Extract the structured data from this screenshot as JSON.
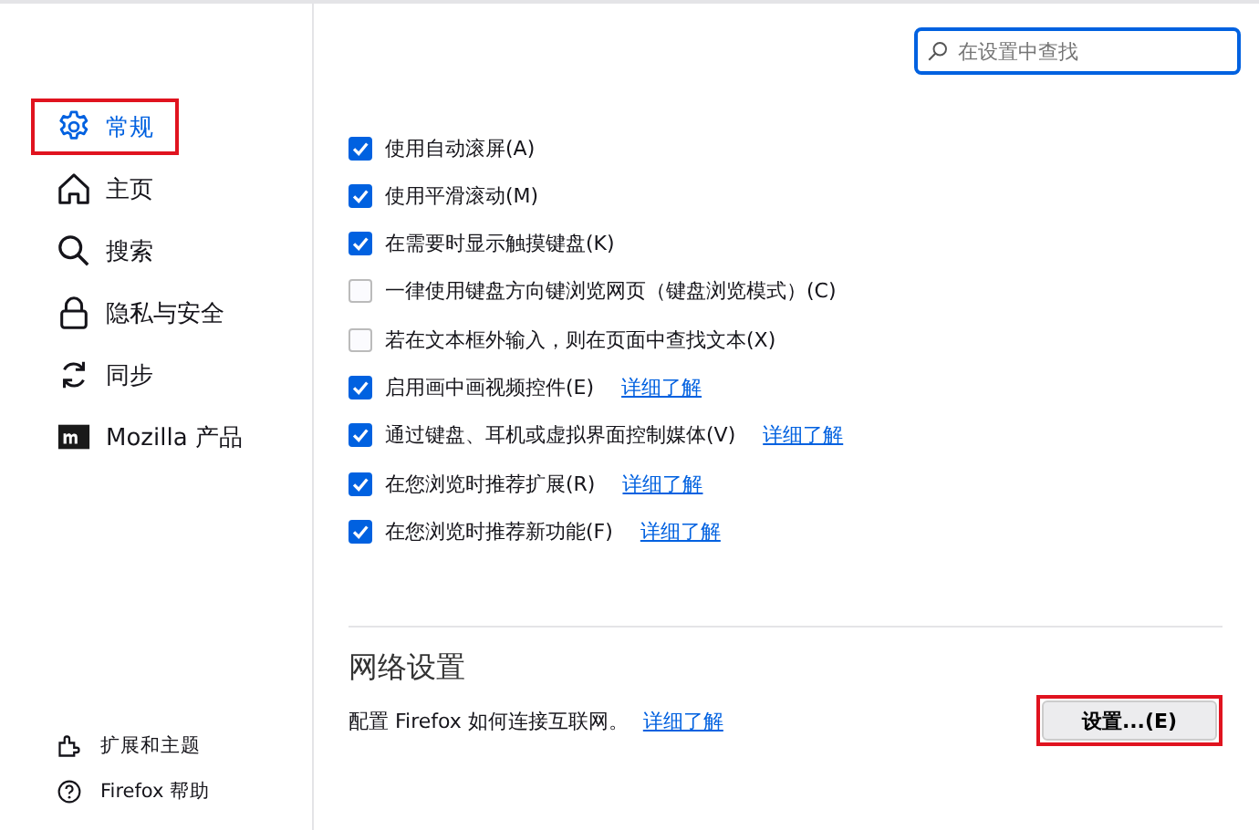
{
  "sidebar": {
    "items": [
      {
        "label": "常规",
        "kind": "gear",
        "selected": true,
        "highlighted": true
      },
      {
        "label": "主页",
        "kind": "home",
        "selected": false,
        "highlighted": false
      },
      {
        "label": "搜索",
        "kind": "search",
        "selected": false,
        "highlighted": false
      },
      {
        "label": "隐私与安全",
        "kind": "lock",
        "selected": false,
        "highlighted": false
      },
      {
        "label": "同步",
        "kind": "sync",
        "selected": false,
        "highlighted": false
      },
      {
        "label": "Mozilla 产品",
        "kind": "mozilla",
        "selected": false,
        "highlighted": false
      }
    ],
    "footer": [
      {
        "label": "扩展和主题",
        "kind": "puzzle"
      },
      {
        "label": "Firefox 帮助",
        "kind": "help"
      }
    ]
  },
  "search": {
    "placeholder": "在设置中查找"
  },
  "options": [
    {
      "label": "使用自动滚屏(A)",
      "checked": true
    },
    {
      "label": "使用平滑滚动(M)",
      "checked": true
    },
    {
      "label": "在需要时显示触摸键盘(K)",
      "checked": true
    },
    {
      "label": "一律使用键盘方向键浏览网页（键盘浏览模式）(C)",
      "checked": false
    },
    {
      "label": "若在文本框外输入，则在页面中查找文本(X)",
      "checked": false
    },
    {
      "label": "启用画中画视频控件(E)",
      "checked": true,
      "link": "详细了解"
    },
    {
      "label": "通过键盘、耳机或虚拟界面控制媒体(V)",
      "checked": true,
      "link": "详细了解"
    },
    {
      "label": "在您浏览时推荐扩展(R)",
      "checked": true,
      "link": "详细了解"
    },
    {
      "label": "在您浏览时推荐新功能(F)",
      "checked": true,
      "link": "详细了解"
    }
  ],
  "network": {
    "heading": "网络设置",
    "description": "配置 Firefox 如何连接互联网。",
    "link": "详细了解",
    "button": {
      "label": "设置...(E)",
      "highlighted": true
    }
  }
}
